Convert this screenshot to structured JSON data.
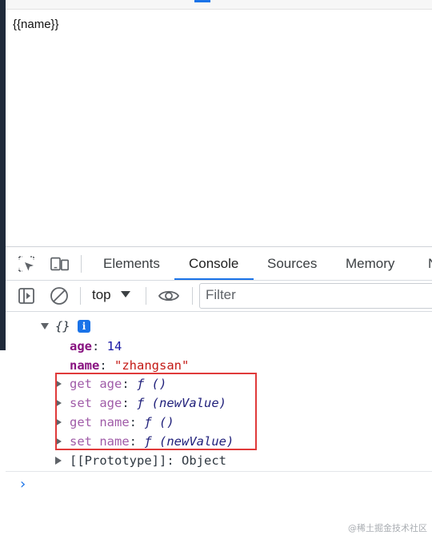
{
  "page": {
    "template_text": "{{name}}"
  },
  "devtools": {
    "tabs": [
      {
        "label": "Elements",
        "active": false
      },
      {
        "label": "Console",
        "active": true
      },
      {
        "label": "Sources",
        "active": false
      },
      {
        "label": "Memory",
        "active": false
      },
      {
        "label": "N",
        "active": false
      }
    ],
    "toolbar": {
      "context": "top",
      "filter_placeholder": "Filter",
      "icons": [
        "inspect-element-icon",
        "device-toggle-icon",
        "sidebar-toggle-icon",
        "clear-console-icon",
        "eye-icon"
      ]
    },
    "console": {
      "object_preview": "{}",
      "info_badge": "i",
      "props": [
        {
          "key": "age",
          "value": "14"
        },
        {
          "key": "name",
          "value": "\"zhangsan\""
        }
      ],
      "accessors": [
        {
          "kind": "get age",
          "fn": "ƒ ()"
        },
        {
          "kind": "set age",
          "fn": "ƒ (newValue)"
        },
        {
          "kind": "get name",
          "fn": "ƒ ()"
        },
        {
          "kind": "set name",
          "fn": "ƒ (newValue)"
        }
      ],
      "prototype": {
        "key": "[[Prototype]]",
        "value": "Object"
      },
      "prompt_symbol": "›"
    },
    "highlight_color": "#e03a3a",
    "accent_color": "#1a73e8"
  },
  "watermark": "@稀土掘金技术社区"
}
